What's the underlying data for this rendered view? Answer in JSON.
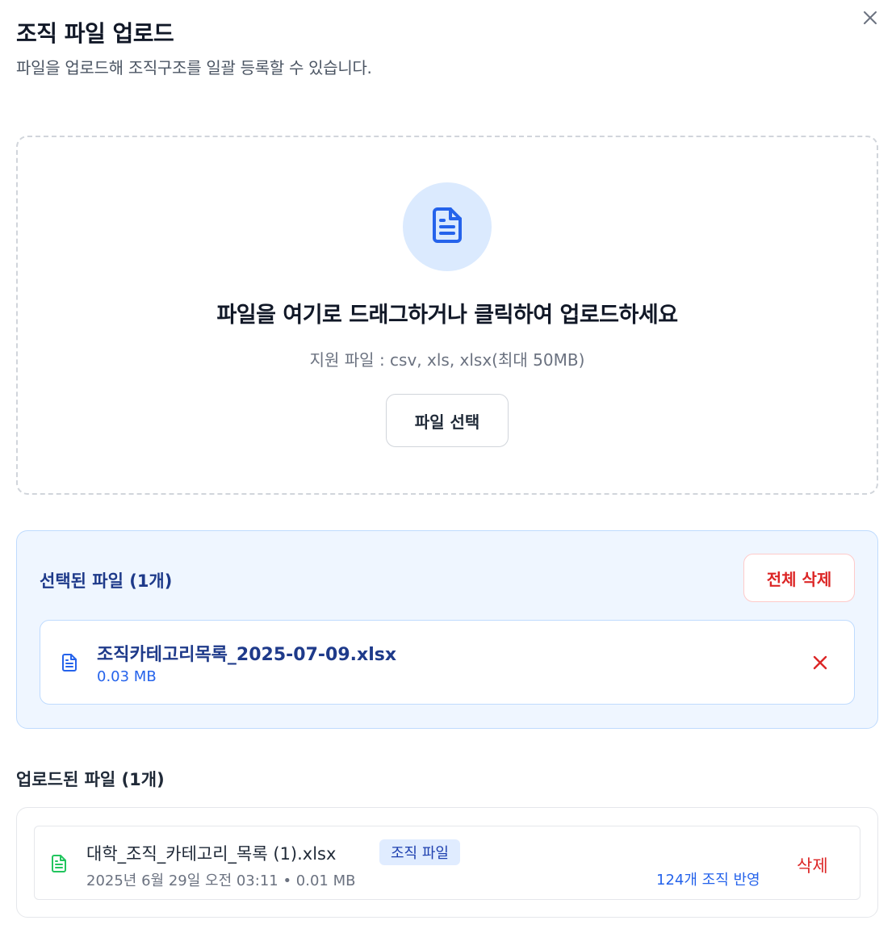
{
  "header": {
    "title": "조직 파일 업로드",
    "subtitle": "파일을 업로드해 조직구조를 일괄 등록할 수 있습니다.",
    "close_icon": "close-icon"
  },
  "dropzone": {
    "icon": "document-icon",
    "title": "파일을 여기로 드래그하거나 클릭하여 업로드하세요",
    "hint": "지원 파일 : csv, xls, xlsx(최대 50MB)",
    "select_label": "파일 선택"
  },
  "selected": {
    "heading": "선택된 파일 (1개)",
    "delete_all_label": "전체 삭제",
    "files": [
      {
        "name": "조직카테고리목록_2025-07-09.xlsx",
        "size": "0.03 MB",
        "icon": "document-icon"
      }
    ]
  },
  "uploaded": {
    "heading": "업로드된 파일 (1개)",
    "files": [
      {
        "name": "대학_조직_카테고리_목록 (1).xlsx",
        "badge": "조직 파일",
        "meta": "2025년 6월 29일 오전 03:11 • 0.01 MB",
        "reflect": "124개 조직 반영",
        "delete_label": "삭제",
        "icon": "spreadsheet-icon"
      }
    ]
  },
  "colors": {
    "accent": "#2563eb",
    "accent_dark": "#1e3a8a",
    "danger": "#dc2626",
    "success_icon": "#22c55e",
    "panel_bg": "#eff6ff"
  }
}
